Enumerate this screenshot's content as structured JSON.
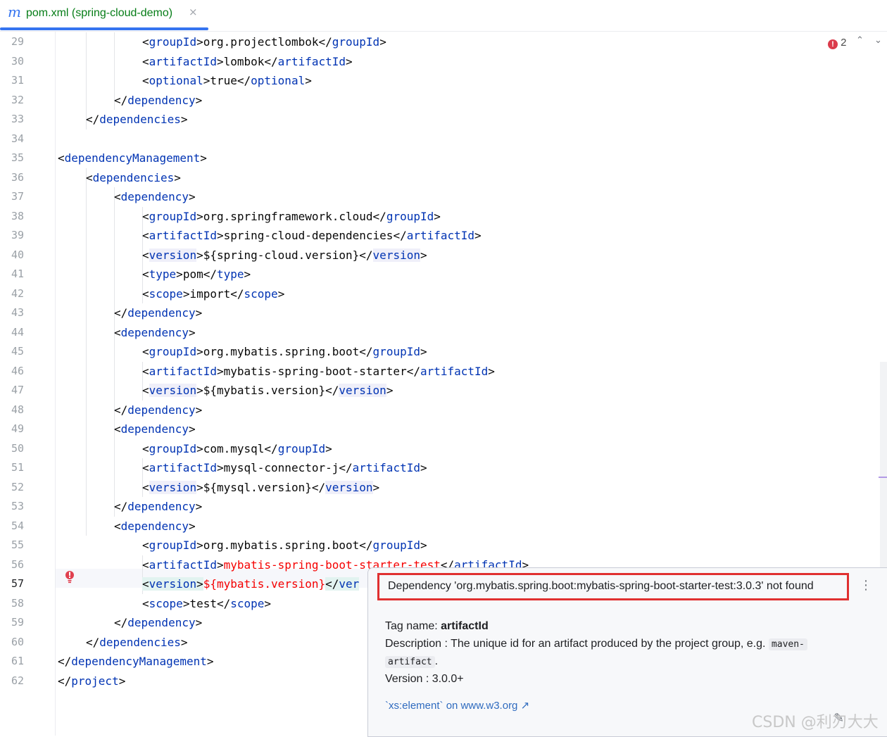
{
  "tab": {
    "icon": "maven-m-icon",
    "icon_glyph": "m",
    "title": "pom.xml (spring-cloud-demo)",
    "close": "×"
  },
  "inspection": {
    "count": "2",
    "up": "^",
    "down": "v"
  },
  "editor": {
    "current_line": 57,
    "lines": [
      {
        "n": "29",
        "indent": 3,
        "parts": [
          [
            "br",
            "<"
          ],
          [
            "tag",
            "groupId"
          ],
          [
            "br",
            ">"
          ],
          [
            "txt",
            "org.projectlombok"
          ],
          [
            "br",
            "</"
          ],
          [
            "tag",
            "groupId"
          ],
          [
            "br",
            ">"
          ]
        ]
      },
      {
        "n": "30",
        "indent": 3,
        "parts": [
          [
            "br",
            "<"
          ],
          [
            "tag",
            "artifactId"
          ],
          [
            "br",
            ">"
          ],
          [
            "txt",
            "lombok"
          ],
          [
            "br",
            "</"
          ],
          [
            "tag",
            "artifactId"
          ],
          [
            "br",
            ">"
          ]
        ]
      },
      {
        "n": "31",
        "indent": 3,
        "parts": [
          [
            "br",
            "<"
          ],
          [
            "tag",
            "optional"
          ],
          [
            "br",
            ">"
          ],
          [
            "txt",
            "true"
          ],
          [
            "br",
            "</"
          ],
          [
            "tag",
            "optional"
          ],
          [
            "br",
            ">"
          ]
        ]
      },
      {
        "n": "32",
        "indent": 2,
        "parts": [
          [
            "br",
            "</"
          ],
          [
            "tag",
            "dependency"
          ],
          [
            "br",
            ">"
          ]
        ]
      },
      {
        "n": "33",
        "indent": 1,
        "parts": [
          [
            "br",
            "</"
          ],
          [
            "tag",
            "dependencies"
          ],
          [
            "br",
            ">"
          ]
        ]
      },
      {
        "n": "34",
        "indent": 0,
        "parts": []
      },
      {
        "n": "35",
        "indent": 0,
        "parts": [
          [
            "br",
            "<"
          ],
          [
            "tag",
            "dependencyManagement"
          ],
          [
            "br",
            ">"
          ]
        ]
      },
      {
        "n": "36",
        "indent": 1,
        "parts": [
          [
            "br",
            "<"
          ],
          [
            "tag",
            "dependencies"
          ],
          [
            "br",
            ">"
          ]
        ]
      },
      {
        "n": "37",
        "indent": 2,
        "parts": [
          [
            "br",
            "<"
          ],
          [
            "tag",
            "dependency"
          ],
          [
            "br",
            ">"
          ]
        ]
      },
      {
        "n": "38",
        "indent": 3,
        "parts": [
          [
            "br",
            "<"
          ],
          [
            "tag",
            "groupId"
          ],
          [
            "br",
            ">"
          ],
          [
            "txt",
            "org.springframework.cloud"
          ],
          [
            "br",
            "</"
          ],
          [
            "tag",
            "groupId"
          ],
          [
            "br",
            ">"
          ]
        ]
      },
      {
        "n": "39",
        "indent": 3,
        "parts": [
          [
            "br",
            "<"
          ],
          [
            "tag",
            "artifactId"
          ],
          [
            "br",
            ">"
          ],
          [
            "txt",
            "spring-cloud-dependencies"
          ],
          [
            "br",
            "</"
          ],
          [
            "tag",
            "artifactId"
          ],
          [
            "br",
            ">"
          ]
        ]
      },
      {
        "n": "40",
        "indent": 3,
        "parts": [
          [
            "br",
            "<"
          ],
          [
            "taghl",
            "version"
          ],
          [
            "br",
            ">"
          ],
          [
            "txt",
            "${spring-cloud.version}"
          ],
          [
            "br",
            "</"
          ],
          [
            "taghl",
            "version"
          ],
          [
            "br",
            ">"
          ]
        ]
      },
      {
        "n": "41",
        "indent": 3,
        "parts": [
          [
            "br",
            "<"
          ],
          [
            "tag",
            "type"
          ],
          [
            "br",
            ">"
          ],
          [
            "txt",
            "pom"
          ],
          [
            "br",
            "</"
          ],
          [
            "tag",
            "type"
          ],
          [
            "br",
            ">"
          ]
        ]
      },
      {
        "n": "42",
        "indent": 3,
        "parts": [
          [
            "br",
            "<"
          ],
          [
            "tag",
            "scope"
          ],
          [
            "br",
            ">"
          ],
          [
            "txt",
            "import"
          ],
          [
            "br",
            "</"
          ],
          [
            "tag",
            "scope"
          ],
          [
            "br",
            ">"
          ]
        ]
      },
      {
        "n": "43",
        "indent": 2,
        "parts": [
          [
            "br",
            "</"
          ],
          [
            "tag",
            "dependency"
          ],
          [
            "br",
            ">"
          ]
        ]
      },
      {
        "n": "44",
        "indent": 2,
        "parts": [
          [
            "br",
            "<"
          ],
          [
            "tag",
            "dependency"
          ],
          [
            "br",
            ">"
          ]
        ]
      },
      {
        "n": "45",
        "indent": 3,
        "parts": [
          [
            "br",
            "<"
          ],
          [
            "tag",
            "groupId"
          ],
          [
            "br",
            ">"
          ],
          [
            "txt",
            "org.mybatis.spring.boot"
          ],
          [
            "br",
            "</"
          ],
          [
            "tag",
            "groupId"
          ],
          [
            "br",
            ">"
          ]
        ]
      },
      {
        "n": "46",
        "indent": 3,
        "parts": [
          [
            "br",
            "<"
          ],
          [
            "tag",
            "artifactId"
          ],
          [
            "br",
            ">"
          ],
          [
            "txt",
            "mybatis-spring-boot-starter"
          ],
          [
            "br",
            "</"
          ],
          [
            "tag",
            "artifactId"
          ],
          [
            "br",
            ">"
          ]
        ]
      },
      {
        "n": "47",
        "indent": 3,
        "parts": [
          [
            "br",
            "<"
          ],
          [
            "taghl",
            "version"
          ],
          [
            "br",
            ">"
          ],
          [
            "txt",
            "${mybatis.version}"
          ],
          [
            "br",
            "</"
          ],
          [
            "taghl",
            "version"
          ],
          [
            "br",
            ">"
          ]
        ]
      },
      {
        "n": "48",
        "indent": 2,
        "parts": [
          [
            "br",
            "</"
          ],
          [
            "tag",
            "dependency"
          ],
          [
            "br",
            ">"
          ]
        ]
      },
      {
        "n": "49",
        "indent": 2,
        "parts": [
          [
            "br",
            "<"
          ],
          [
            "tag",
            "dependency"
          ],
          [
            "br",
            ">"
          ]
        ]
      },
      {
        "n": "50",
        "indent": 3,
        "parts": [
          [
            "br",
            "<"
          ],
          [
            "tag",
            "groupId"
          ],
          [
            "br",
            ">"
          ],
          [
            "txt",
            "com.mysql"
          ],
          [
            "br",
            "</"
          ],
          [
            "tag",
            "groupId"
          ],
          [
            "br",
            ">"
          ]
        ]
      },
      {
        "n": "51",
        "indent": 3,
        "parts": [
          [
            "br",
            "<"
          ],
          [
            "tag",
            "artifactId"
          ],
          [
            "br",
            ">"
          ],
          [
            "txt",
            "mysql-connector-j"
          ],
          [
            "br",
            "</"
          ],
          [
            "tag",
            "artifactId"
          ],
          [
            "br",
            ">"
          ]
        ]
      },
      {
        "n": "52",
        "indent": 3,
        "parts": [
          [
            "br",
            "<"
          ],
          [
            "taghl",
            "version"
          ],
          [
            "br",
            ">"
          ],
          [
            "txt",
            "${mysql.version}"
          ],
          [
            "br",
            "</"
          ],
          [
            "taghl",
            "version"
          ],
          [
            "br",
            ">"
          ]
        ]
      },
      {
        "n": "53",
        "indent": 2,
        "parts": [
          [
            "br",
            "</"
          ],
          [
            "tag",
            "dependency"
          ],
          [
            "br",
            ">"
          ]
        ]
      },
      {
        "n": "54",
        "indent": 2,
        "parts": [
          [
            "br",
            "<"
          ],
          [
            "tag",
            "dependency"
          ],
          [
            "br",
            ">"
          ]
        ]
      },
      {
        "n": "55",
        "indent": 3,
        "parts": [
          [
            "br",
            "<"
          ],
          [
            "tag",
            "groupId"
          ],
          [
            "br",
            ">"
          ],
          [
            "txt",
            "org.mybatis.spring.boot"
          ],
          [
            "br",
            "</"
          ],
          [
            "tag",
            "groupId"
          ],
          [
            "br",
            ">"
          ]
        ]
      },
      {
        "n": "56",
        "indent": 3,
        "parts": [
          [
            "br",
            "<"
          ],
          [
            "tag",
            "artifactId"
          ],
          [
            "br",
            ">"
          ],
          [
            "err",
            "mybatis-spring-boot-starter-test"
          ],
          [
            "br",
            "</"
          ],
          [
            "tag",
            "artifactId"
          ],
          [
            "br",
            ">"
          ]
        ]
      },
      {
        "n": "57",
        "indent": 3,
        "parts": [
          [
            "brerr",
            "<"
          ],
          [
            "tagerr",
            "version"
          ],
          [
            "brerr",
            ">"
          ],
          [
            "err",
            "${mybatis.version}"
          ],
          [
            "brerr",
            "</"
          ],
          [
            "tagerr",
            "ver"
          ]
        ]
      },
      {
        "n": "58",
        "indent": 3,
        "parts": [
          [
            "br",
            "<"
          ],
          [
            "tag",
            "scope"
          ],
          [
            "br",
            ">"
          ],
          [
            "txt",
            "test"
          ],
          [
            "br",
            "</"
          ],
          [
            "tag",
            "scope"
          ],
          [
            "br",
            ">"
          ]
        ]
      },
      {
        "n": "59",
        "indent": 2,
        "parts": [
          [
            "br",
            "</"
          ],
          [
            "tag",
            "dependency"
          ],
          [
            "br",
            ">"
          ]
        ]
      },
      {
        "n": "60",
        "indent": 1,
        "parts": [
          [
            "br",
            "</"
          ],
          [
            "tag",
            "dependencies"
          ],
          [
            "br",
            ">"
          ]
        ]
      },
      {
        "n": "61",
        "indent": 0,
        "parts": [
          [
            "br",
            "</"
          ],
          [
            "tag",
            "dependencyManagement"
          ],
          [
            "br",
            ">"
          ]
        ]
      },
      {
        "n": "62",
        "indent": 0,
        "parts": [
          [
            "br",
            "</"
          ],
          [
            "tag",
            "project"
          ],
          [
            "br",
            ">"
          ]
        ]
      }
    ]
  },
  "popup": {
    "message": "Dependency 'org.mybatis.spring.boot:mybatis-spring-boot-starter-test:3.0.3' not found",
    "more": "⋮",
    "tag_label": "Tag name: ",
    "tag_value": "artifactId",
    "description_prefix": "Description : The unique id for an artifact produced by the project group, e.g. ",
    "code1": "maven-",
    "code2": "artifact",
    "description_suffix": ".",
    "version": "Version : 3.0.0+",
    "link": "`xs:element` on www.w3.org ↗"
  },
  "watermark": "CSDN @利刃大大",
  "colors": {
    "tag": "#0033b3",
    "error": "#f50000",
    "accent": "#3574f0",
    "tab_title": "#067d17"
  }
}
